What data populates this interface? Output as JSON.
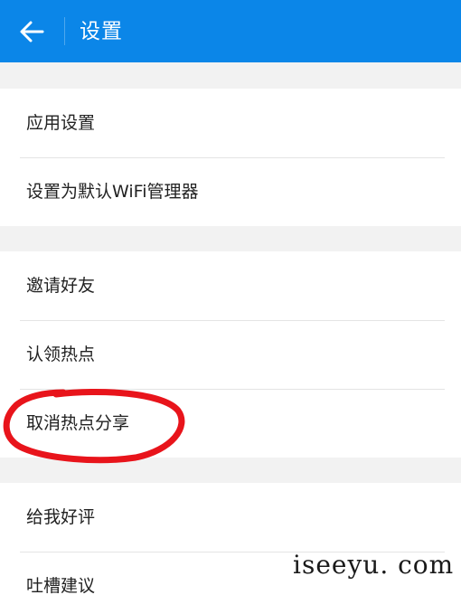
{
  "header": {
    "title": "设置",
    "back_icon": "arrow-left-icon",
    "background_color": "#0b86e8"
  },
  "groups": [
    {
      "items": [
        {
          "label": "应用设置"
        },
        {
          "label": "设置为默认WiFi管理器"
        }
      ]
    },
    {
      "items": [
        {
          "label": "邀请好友"
        },
        {
          "label": "认领热点"
        },
        {
          "label": "取消热点分享"
        }
      ]
    },
    {
      "items": [
        {
          "label": "给我好评"
        },
        {
          "label": "吐槽建议"
        }
      ]
    }
  ],
  "annotation": {
    "color": "#e8141b",
    "target": "取消热点分享"
  },
  "watermark": "iseeyu. com"
}
